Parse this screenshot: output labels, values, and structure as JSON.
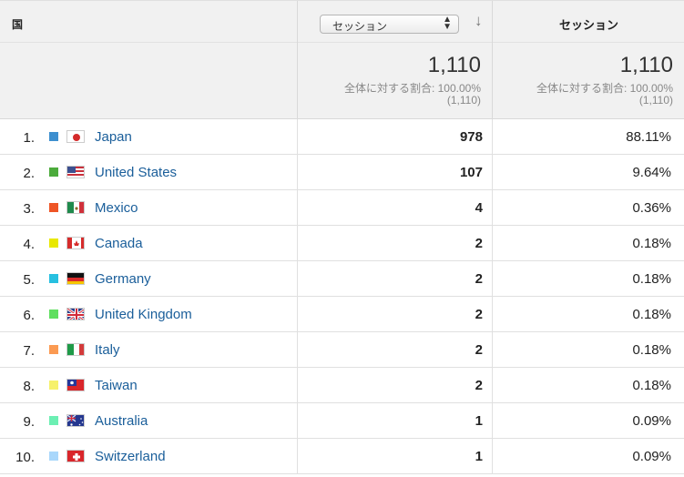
{
  "header": {
    "dimension_label": "国",
    "metric_select_value": "セッション",
    "metric_column_label": "セッション"
  },
  "summary": {
    "sessions_total": "1,110",
    "sessions_pct_label": "全体に対する割合: 100.00%",
    "sessions_abs": "(1,110)",
    "share_total": "1,110",
    "share_pct_label": "全体に対する割合: 100.00%",
    "share_abs": "(1,110)"
  },
  "rows": [
    {
      "index": "1.",
      "country": "Japan",
      "sessions": "978",
      "percent": "88.11%",
      "color": "#3d8fcf",
      "flag": "japan-flag-icon"
    },
    {
      "index": "2.",
      "country": "United States",
      "sessions": "107",
      "percent": "9.64%",
      "color": "#4cab3c",
      "flag": "us-flag-icon"
    },
    {
      "index": "3.",
      "country": "Mexico",
      "sessions": "4",
      "percent": "0.36%",
      "color": "#ee5526",
      "flag": "mexico-flag-icon"
    },
    {
      "index": "4.",
      "country": "Canada",
      "sessions": "2",
      "percent": "0.18%",
      "color": "#e8e800",
      "flag": "canada-flag-icon"
    },
    {
      "index": "5.",
      "country": "Germany",
      "sessions": "2",
      "percent": "0.18%",
      "color": "#27c0e0",
      "flag": "germany-flag-icon"
    },
    {
      "index": "6.",
      "country": "United Kingdom",
      "sessions": "2",
      "percent": "0.18%",
      "color": "#5fdf5f",
      "flag": "uk-flag-icon"
    },
    {
      "index": "7.",
      "country": "Italy",
      "sessions": "2",
      "percent": "0.18%",
      "color": "#fb9a52",
      "flag": "italy-flag-icon"
    },
    {
      "index": "8.",
      "country": "Taiwan",
      "sessions": "2",
      "percent": "0.18%",
      "color": "#f6f16a",
      "flag": "taiwan-flag-icon"
    },
    {
      "index": "9.",
      "country": "Australia",
      "sessions": "1",
      "percent": "0.09%",
      "color": "#6cefb3",
      "flag": "australia-flag-icon"
    },
    {
      "index": "10.",
      "country": "Switzerland",
      "sessions": "1",
      "percent": "0.09%",
      "color": "#a9d7fb",
      "flag": "switzerland-flag-icon"
    }
  ]
}
